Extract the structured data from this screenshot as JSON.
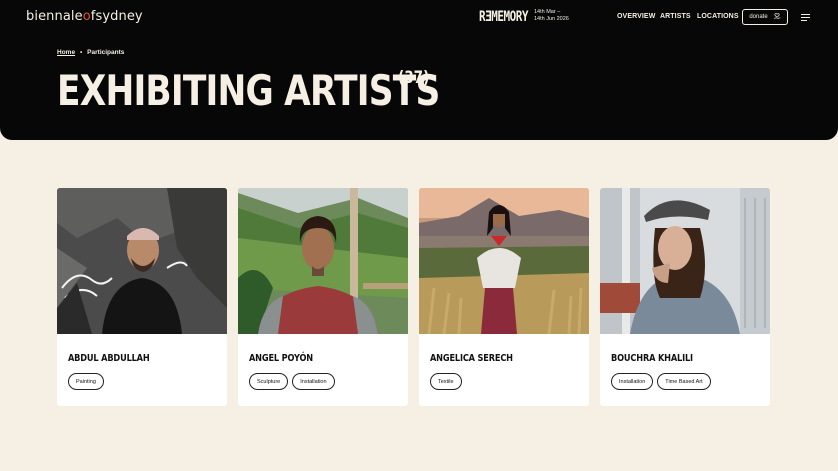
{
  "header": {
    "logo": {
      "part1": "biennale",
      "part2": "o",
      "part3": "fsydney"
    },
    "rememory": {
      "word": "RƎMEMORY",
      "date_line1": "14th Mar –",
      "date_line2": "14th Jun 2026"
    },
    "nav": [
      {
        "label": "Overview"
      },
      {
        "label": "Artists"
      },
      {
        "label": "Locations"
      }
    ],
    "donate_label": "donate",
    "donate_icon": "hand-heart-icon",
    "menu_icon": "hamburger-menu-icon"
  },
  "breadcrumb": {
    "home": "Home",
    "separator": "•",
    "current": "Participants"
  },
  "page": {
    "title": "EXHIBITING ARTISTS",
    "count": "(37)"
  },
  "artists": [
    {
      "name": "Abdul Abdullah",
      "tags": [
        "Painting"
      ]
    },
    {
      "name": "Angel Poyón",
      "tags": [
        "Sculpture",
        "Installation"
      ]
    },
    {
      "name": "Angelica Serech",
      "tags": [
        "Textile"
      ]
    },
    {
      "name": "Bouchra Khalili",
      "tags": [
        "Installation",
        "Time Based Art"
      ]
    }
  ],
  "colors": {
    "header_bg": "#070707",
    "page_bg": "#f5efe4",
    "accent": "#e0533e"
  }
}
